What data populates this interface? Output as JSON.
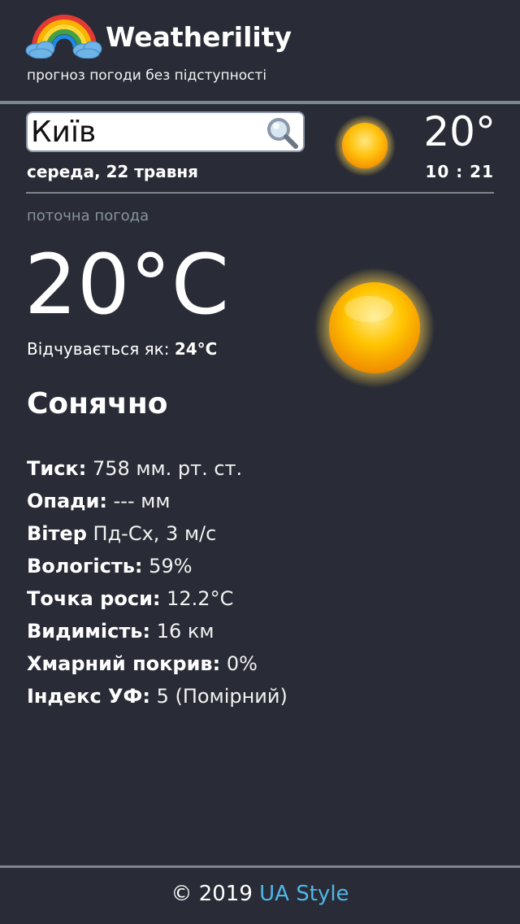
{
  "app": {
    "title": "Weatherility",
    "subtitle": "прогноз погоди без підступності",
    "logo_icon": "rainbow-clouds-icon"
  },
  "search": {
    "value": "Київ",
    "icon": "search-icon"
  },
  "top_bar": {
    "date": "середа, 22 травня",
    "temp": "20°",
    "time": "10 : 21",
    "weather_icon": "sun-icon"
  },
  "current": {
    "section_label": "поточна погода",
    "temperature": "20°C",
    "feels_like_label": "Відчувається як:",
    "feels_like_value": "24°C",
    "condition": "Сонячно",
    "weather_icon": "sun-icon"
  },
  "details": [
    {
      "label": "Тиск:",
      "value": "758 мм. рт. ст."
    },
    {
      "label": "Опади:",
      "value": "--- мм"
    },
    {
      "label": "Вітер",
      "value": "Пд-Сх, 3 м/с"
    },
    {
      "label": "Вологість:",
      "value": "59%"
    },
    {
      "label": "Точка роси:",
      "value": "12.2°C"
    },
    {
      "label": "Видимість:",
      "value": "16 км"
    },
    {
      "label": "Хмарний покрив:",
      "value": "0%"
    },
    {
      "label": "Індекс УФ:",
      "value": "5 (Помірний)"
    }
  ],
  "footer": {
    "copyright": "© 2019",
    "link": "UA Style"
  },
  "colors": {
    "background": "#292c36",
    "divider": "#7e8590",
    "link": "#4fb6e8",
    "muted": "#8a93a0"
  }
}
